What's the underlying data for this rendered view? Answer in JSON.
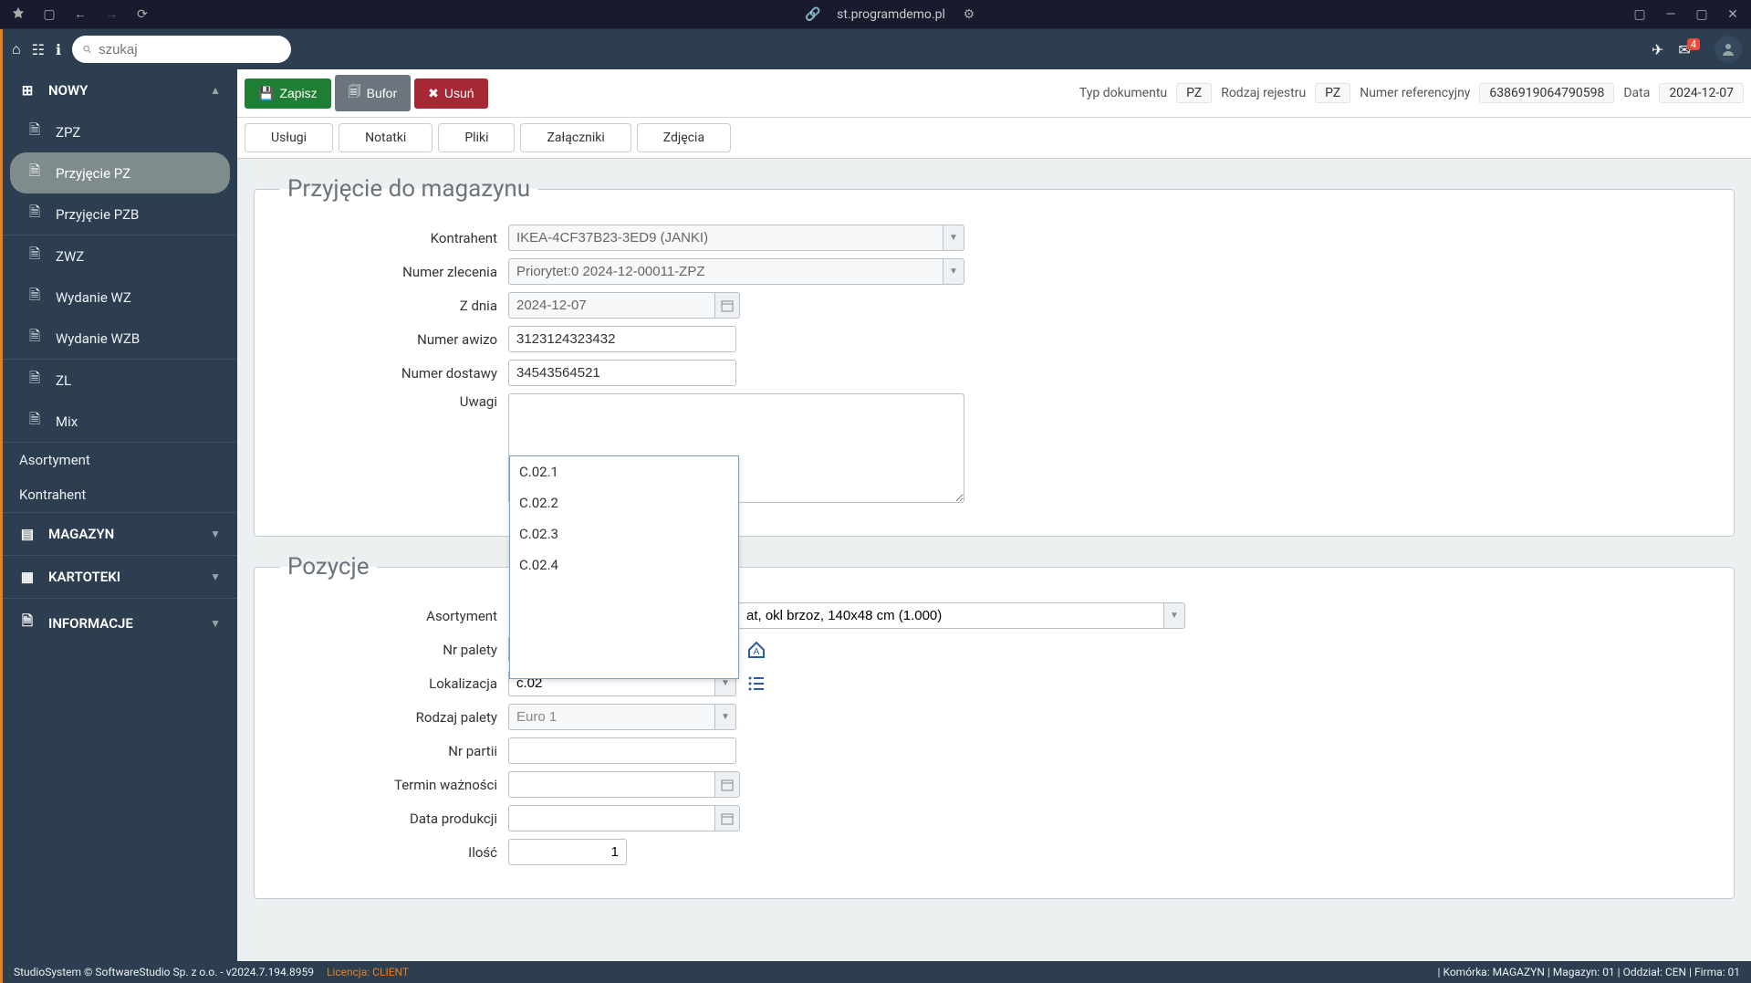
{
  "browser": {
    "url": "st.programdemo.pl"
  },
  "header": {
    "search_placeholder": "szukaj",
    "notif_count": "4"
  },
  "sidebar": {
    "nowy": "NOWY",
    "group1": [
      {
        "label": "ZPZ",
        "id": "zpz"
      },
      {
        "label": "Przyjęcie PZ",
        "id": "przyjecie-pz",
        "active": true
      },
      {
        "label": "Przyjęcie PZB",
        "id": "przyjecie-pzb"
      }
    ],
    "group2": [
      {
        "label": "ZWZ",
        "id": "zwz"
      },
      {
        "label": "Wydanie WZ",
        "id": "wydanie-wz"
      },
      {
        "label": "Wydanie WZB",
        "id": "wydanie-wzb"
      }
    ],
    "group3": [
      {
        "label": "ZL",
        "id": "zl"
      },
      {
        "label": "Mix",
        "id": "mix"
      }
    ],
    "links": [
      {
        "label": "Asortyment",
        "id": "asortyment"
      },
      {
        "label": "Kontrahent",
        "id": "kontrahent"
      }
    ],
    "sections": [
      {
        "label": "MAGAZYN"
      },
      {
        "label": "KARTOTEKI"
      },
      {
        "label": "INFORMACJE"
      }
    ]
  },
  "toolbar": {
    "zapisz": "Zapisz",
    "bufor": "Bufor",
    "usun": "Usuń",
    "meta": {
      "typ": "Typ dokumentu",
      "typ_v": "PZ",
      "rodzaj": "Rodzaj rejestru",
      "rodzaj_v": "PZ",
      "numer": "Numer referencyjny",
      "numer_v": "6386919064790598",
      "data": "Data",
      "data_v": "2024-12-07"
    }
  },
  "tabs": [
    "Usługi",
    "Notatki",
    "Pliki",
    "Załączniki",
    "Zdjęcia"
  ],
  "przyjecie": {
    "legend": "Przyjęcie do magazynu",
    "labels": {
      "kontrahent": "Kontrahent",
      "numer_zlecenia": "Numer zlecenia",
      "z_dnia": "Z dnia",
      "numer_awizo": "Numer awizo",
      "numer_dostawy": "Numer dostawy",
      "uwagi": "Uwagi"
    },
    "kontrahent": "IKEA-4CF37B23-3ED9 (JANKI)",
    "numer_zlecenia": "Priorytet:0 2024-12-00011-ZPZ",
    "z_dnia": "2024-12-07",
    "numer_awizo": "3123124323432",
    "numer_dostawy": "34543564521",
    "uwagi": ""
  },
  "pozycje": {
    "legend": "Pozycje",
    "labels": {
      "asortyment": "Asortyment",
      "nr_palety": "Nr palety",
      "lokalizacja": "Lokalizacja",
      "rodzaj_palety": "Rodzaj palety",
      "nr_partii": "Nr partii",
      "termin": "Termin ważności",
      "data_prod": "Data produkcji",
      "ilosc": "Ilość"
    },
    "asortyment": "at, okl brzoz, 140x48 cm (1.000)",
    "nr_palety": "",
    "lokalizacja": "c.02",
    "lokalizacja_opts": [
      "C.02.1",
      "C.02.2",
      "C.02.3",
      "C.02.4"
    ],
    "rodzaj_palety": "Euro 1",
    "nr_partii": "",
    "termin": "",
    "data_prod": "",
    "ilosc": "1"
  },
  "footer": {
    "left": "StudioSystem © SoftwareStudio Sp. z o.o. - v2024.7.194.8959",
    "lic": "Licencja: CLIENT",
    "right": "| Komórka: MAGAZYN | Magazyn: 01 | Oddział: CEN | Firma: 01"
  }
}
